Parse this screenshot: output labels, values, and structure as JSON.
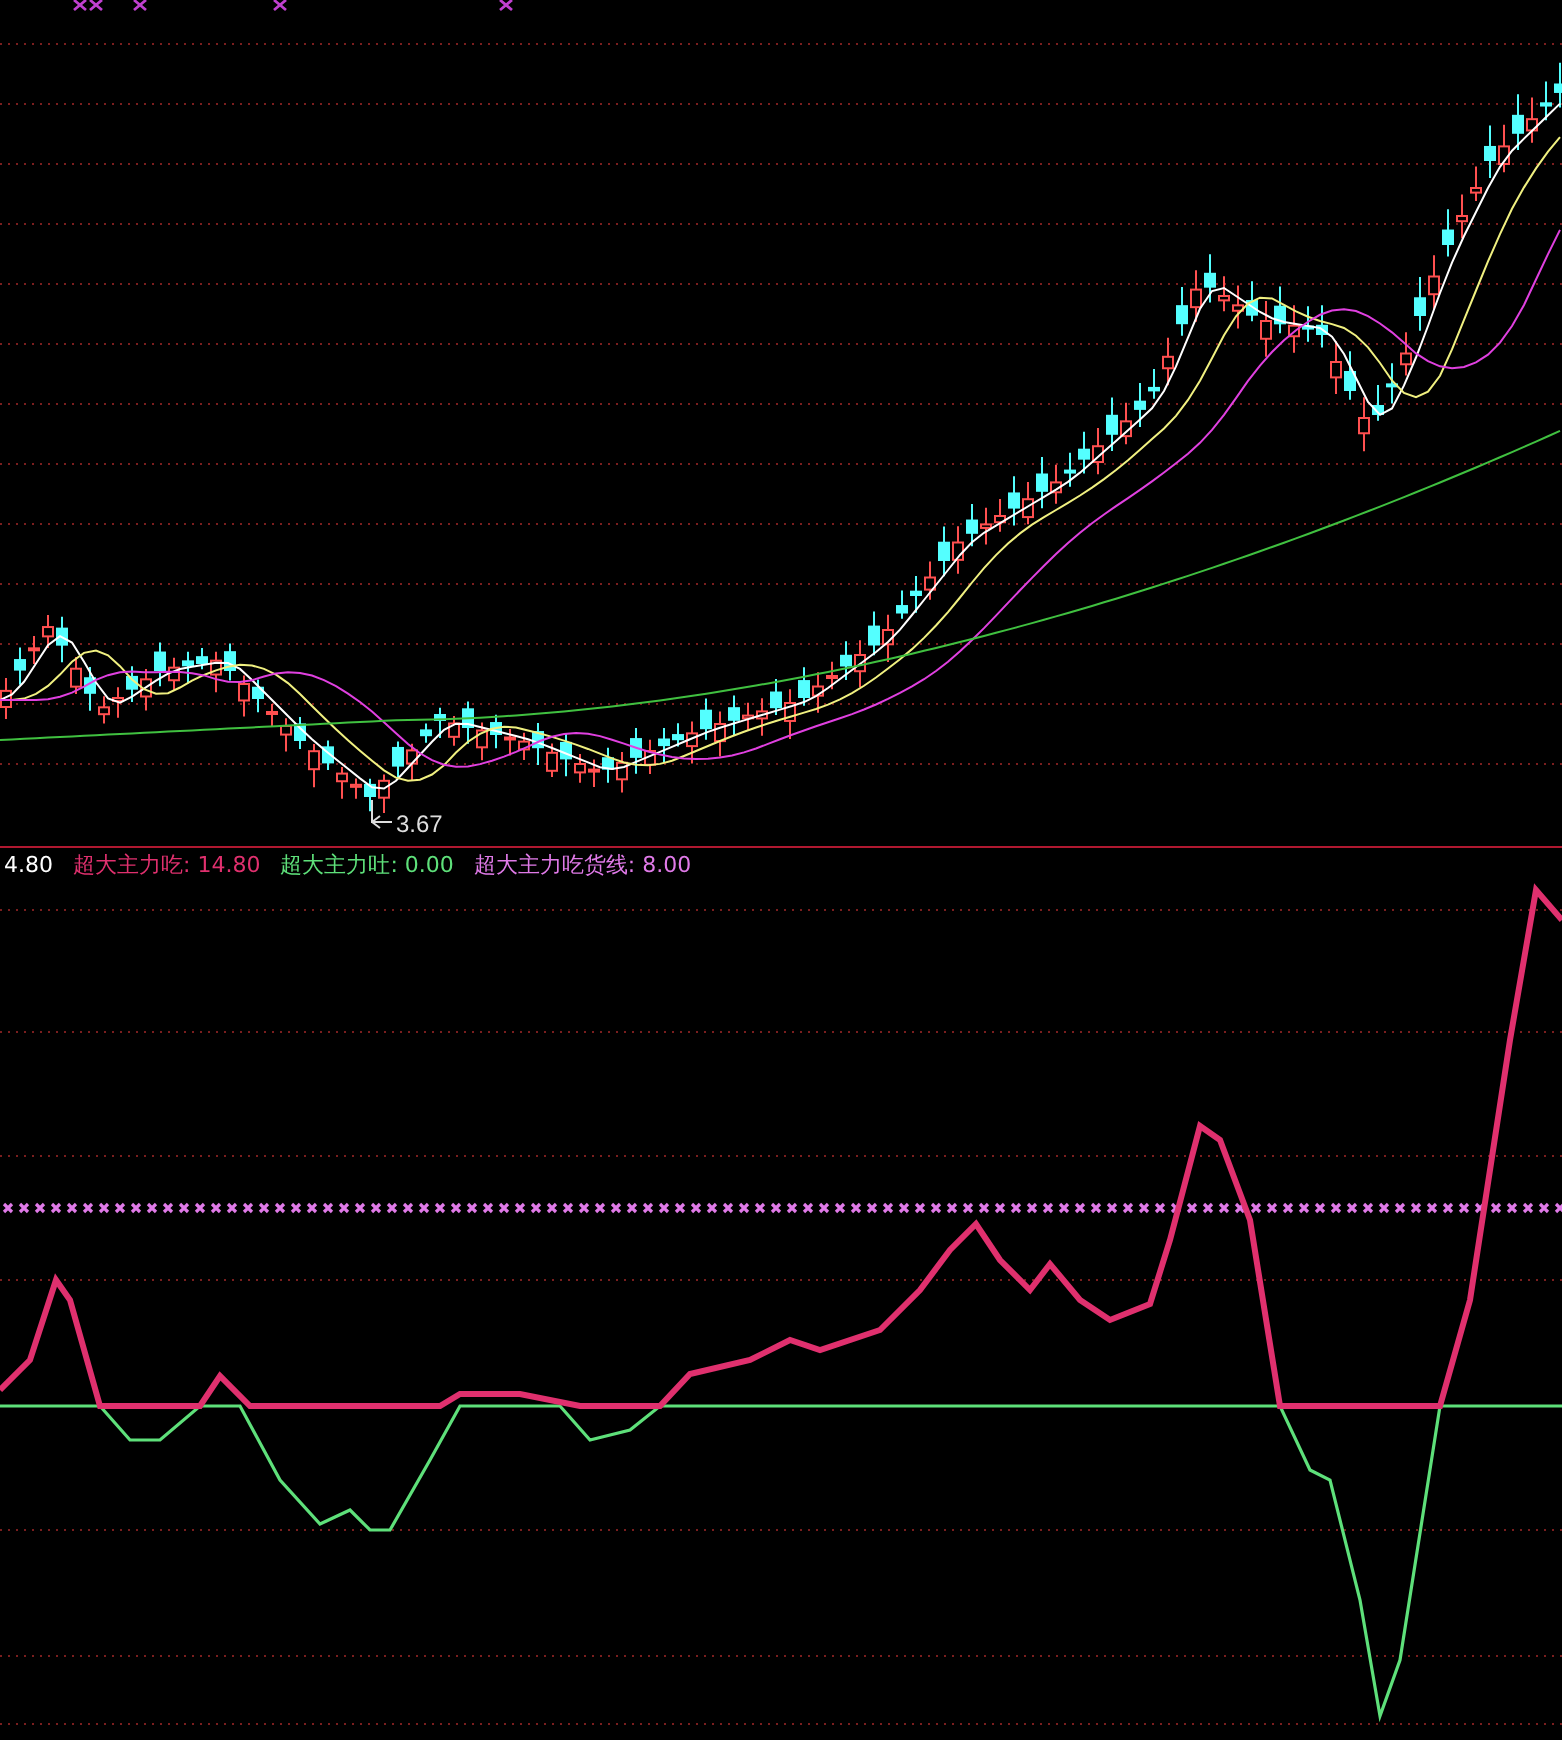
{
  "price_chart": {
    "low_label": "3.67"
  },
  "indicator": {
    "legend": [
      {
        "text": "4.80",
        "color": "#ffffff"
      },
      {
        "text": "超大主力吃: 14.80",
        "color": "#e0306e"
      },
      {
        "text": "超大主力吐: 0.00",
        "color": "#5ee07a"
      },
      {
        "text": "超大主力吃货线: 8.00",
        "color": "#e07ae8"
      }
    ]
  }
}
